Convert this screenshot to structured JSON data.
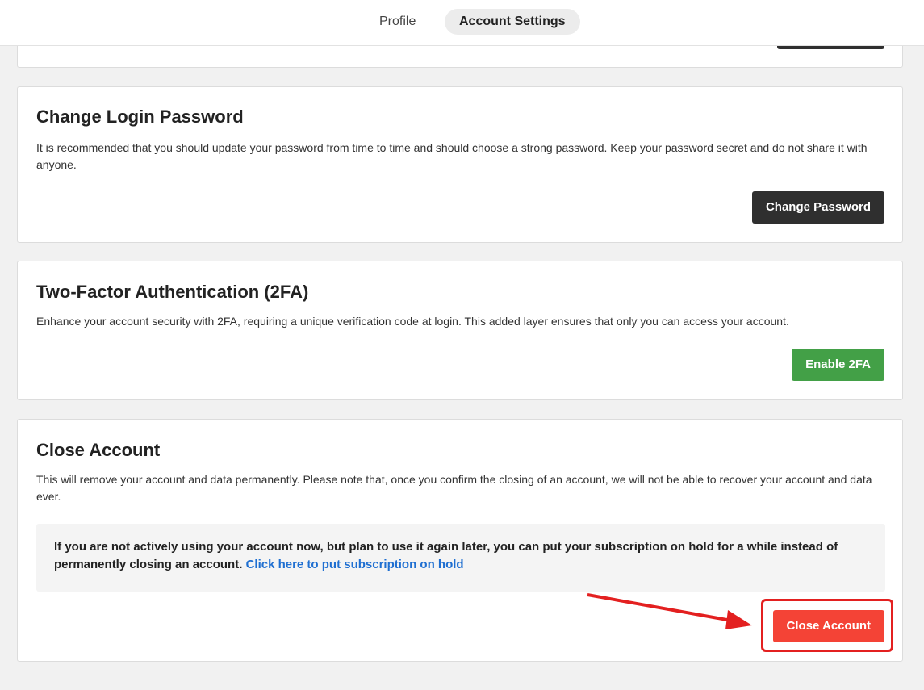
{
  "tabs": [
    {
      "label": "Profile",
      "active": false
    },
    {
      "label": "Account Settings",
      "active": true
    }
  ],
  "password_card": {
    "title": "Change Login Password",
    "description": "It is recommended that you should update your password from time to time and should choose a strong password. Keep your password secret and do not share it with anyone.",
    "button": "Change Password"
  },
  "twofa_card": {
    "title": "Two-Factor Authentication (2FA)",
    "description": "Enhance your account security with 2FA, requiring a unique verification code at login. This added layer ensures that only you can access your account.",
    "button": "Enable 2FA"
  },
  "close_card": {
    "title": "Close Account",
    "description": "This will remove your account and data permanently. Please note that, once you confirm the closing of an account, we will not be able to recover your account and data ever.",
    "notice_text": "If you are not actively using your account now, but plan to use it again later, you can put your subscription on hold for a while instead of permanently closing an account.",
    "notice_link": "Click here to put subscription on hold",
    "button": "Close Account"
  },
  "colors": {
    "accent_red": "#f44336",
    "accent_green": "#43a047",
    "dark_button": "#2f2f2f",
    "link_blue": "#1f6fd1",
    "annotation_red": "#e32020"
  },
  "annotation": {
    "type": "arrow-and-highlight",
    "target": "close-account-button"
  }
}
